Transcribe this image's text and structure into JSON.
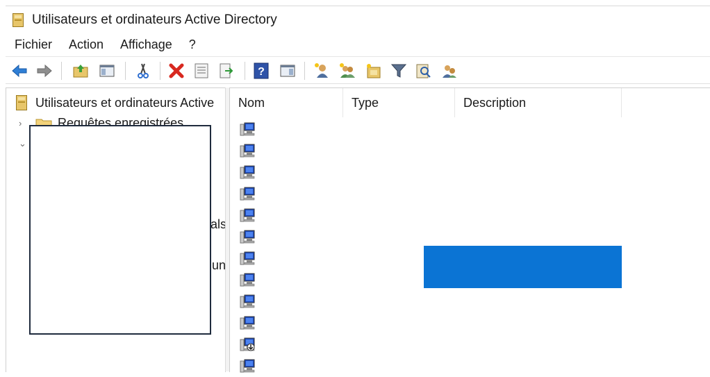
{
  "window": {
    "title": "Utilisateurs et ordinateurs Active Directory"
  },
  "menu": [
    "Fichier",
    "Action",
    "Affichage",
    "?"
  ],
  "toolbar": {
    "buttons": [
      "back-icon",
      "forward-icon",
      "up-folder-icon",
      "show-hide-console-tree-icon",
      "cut-icon",
      "delete-icon",
      "properties-icon",
      "export-icon",
      "help-icon",
      "show-action-pane-icon",
      "new-user-icon",
      "new-group-icon",
      "new-ou-icon",
      "filter-icon",
      "find-icon",
      "add-to-group-icon"
    ]
  },
  "tree": {
    "root_label": "Utilisateurs et ordinateurs Active",
    "saved_queries_label": "Requêtes enregistrées",
    "partial_1": "als",
    "partial_2": "un"
  },
  "list": {
    "columns": [
      "Nom",
      "Type",
      "Description"
    ],
    "row_icons": [
      "computer-icon",
      "computer-icon",
      "computer-icon",
      "computer-icon",
      "computer-icon",
      "computer-icon",
      "computer-icon",
      "computer-icon",
      "computer-icon",
      "computer-icon",
      "computer-disabled-icon",
      "computer-icon"
    ]
  },
  "colors": {
    "accent_blue": "#0b74d4",
    "redaction_border": "#1f2b3d"
  }
}
